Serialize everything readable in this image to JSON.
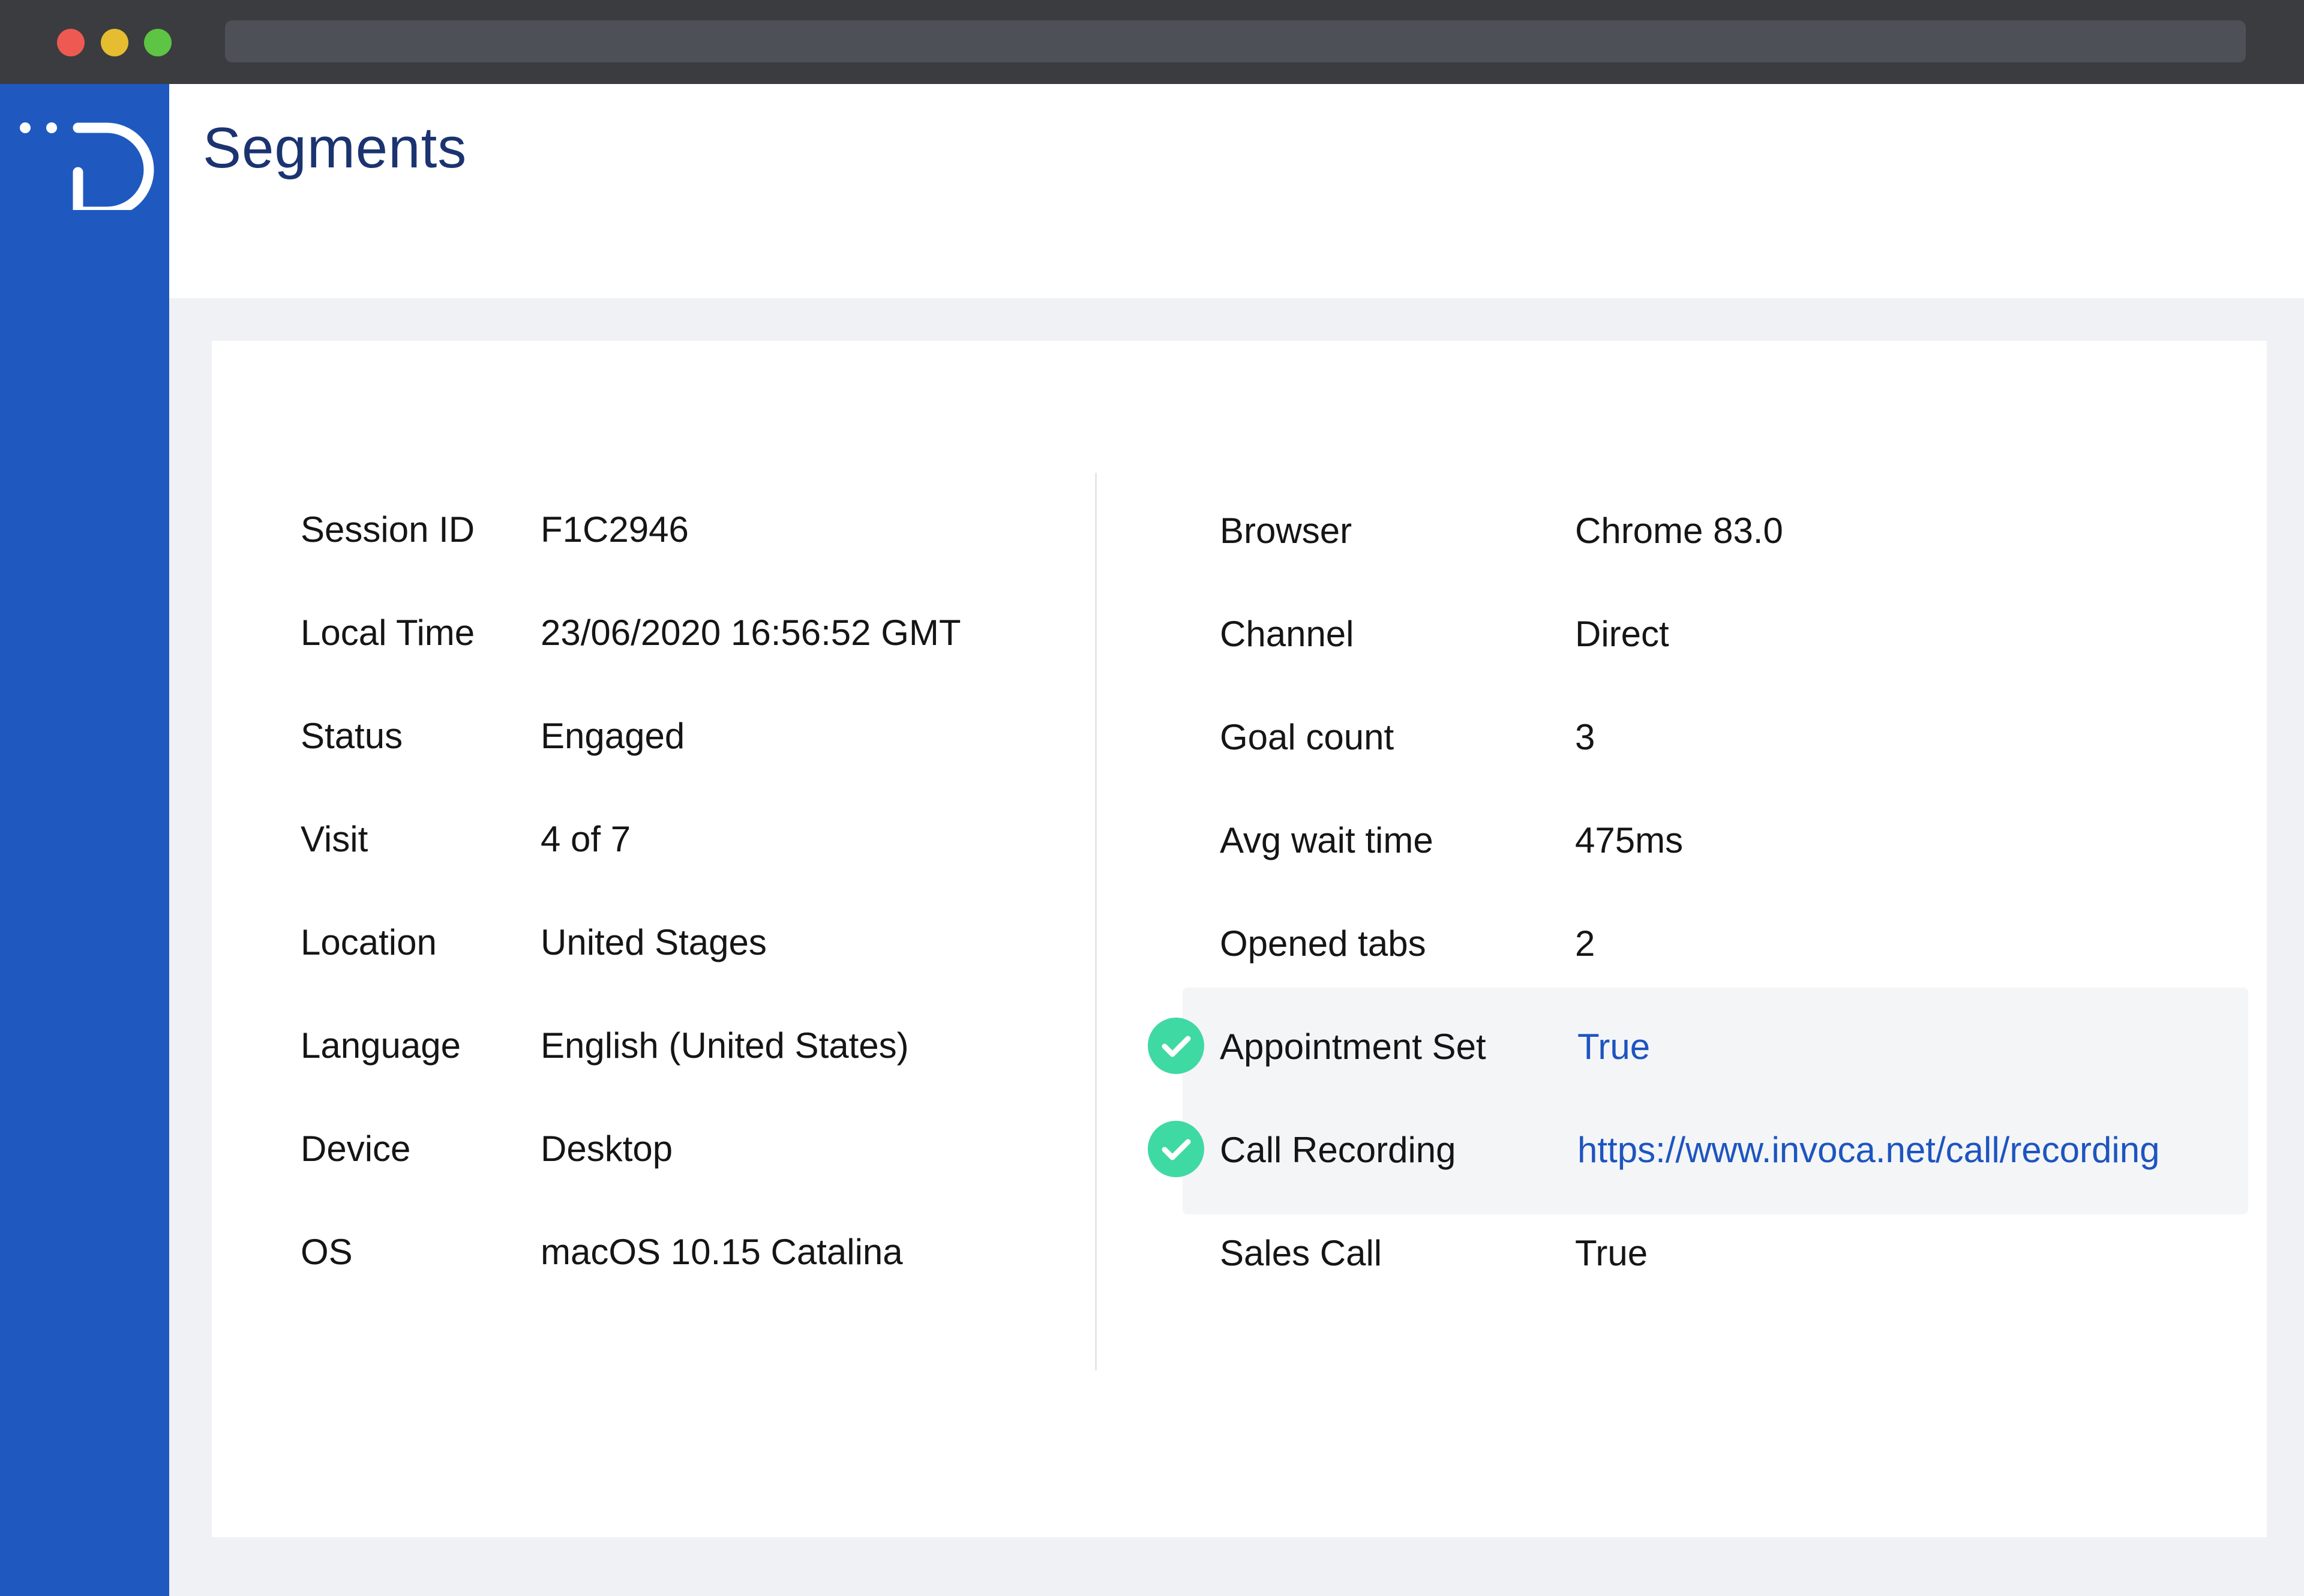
{
  "window": {
    "controls": [
      "close",
      "minimize",
      "maximize"
    ]
  },
  "colors": {
    "sidebar": "#1f59c0",
    "title": "#1b3470",
    "link": "#1d55c0",
    "check": "#3fd9a4"
  },
  "sidebar": {
    "logo_icon": "d-logo-icon"
  },
  "header": {
    "title": "Segments"
  },
  "details": {
    "left": [
      {
        "label": "Session ID",
        "value": "F1C2946"
      },
      {
        "label": "Local Time",
        "value": "23/06/2020 16:56:52 GMT"
      },
      {
        "label": "Status",
        "value": "Engaged"
      },
      {
        "label": "Visit",
        "value": "4 of 7"
      },
      {
        "label": "Location",
        "value": "United Stages"
      },
      {
        "label": "Language",
        "value": "English (United States)"
      },
      {
        "label": "Device",
        "value": "Desktop"
      },
      {
        "label": "OS",
        "value": "macOS 10.15 Catalina"
      }
    ],
    "right": [
      {
        "label": "Browser",
        "value": "Chrome 83.0"
      },
      {
        "label": "Channel",
        "value": "Direct"
      },
      {
        "label": "Goal count",
        "value": "3"
      },
      {
        "label": "Avg wait time",
        "value": "475ms"
      },
      {
        "label": "Opened tabs",
        "value": "2"
      },
      {
        "label": "Appointment Set",
        "value": "True",
        "checked": true,
        "link": true
      },
      {
        "label": "Call Recording",
        "value": "https://www.invoca.net/call/recording",
        "checked": true,
        "link": true
      },
      {
        "label": "Sales Call",
        "value": "True"
      }
    ]
  }
}
